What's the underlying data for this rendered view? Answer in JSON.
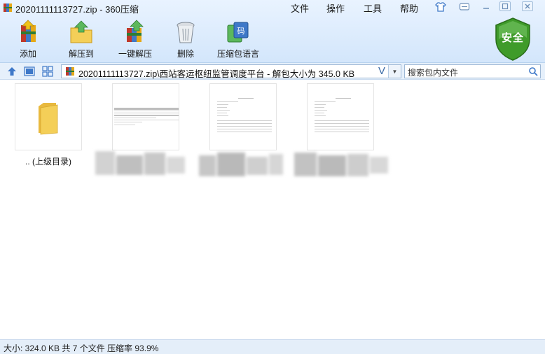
{
  "window": {
    "title": "20201111113727.zip - 360压缩"
  },
  "menu": {
    "file": "文件",
    "operation": "操作",
    "tools": "工具",
    "help": "帮助"
  },
  "toolbar": {
    "add": "添加",
    "extract_to": "解压到",
    "one_click_extract": "一键解压",
    "delete": "删除",
    "archive_language": "压缩包语言"
  },
  "security_badge": "安全",
  "address": {
    "path": "20201111113727.zip\\西站客运枢纽监管调度平台 - 解包大小为 345.0 KB",
    "dropdown_glyph": "V"
  },
  "search": {
    "placeholder": "搜索包内文件"
  },
  "files": [
    {
      "name": ".. (上级目录)",
      "type": "parent-folder"
    },
    {
      "name": "",
      "type": "document"
    },
    {
      "name": "",
      "type": "document"
    },
    {
      "name": "",
      "type": "document"
    }
  ],
  "status_bar": "大小: 324.0 KB 共 7 个文件 压缩率 93.9%",
  "colors": {
    "toolbar_bg": "#d3e6fb",
    "shield_green": "#3f9b2a",
    "folder_yellow": "#f4cf58",
    "icon_blue": "#3e78c8"
  }
}
